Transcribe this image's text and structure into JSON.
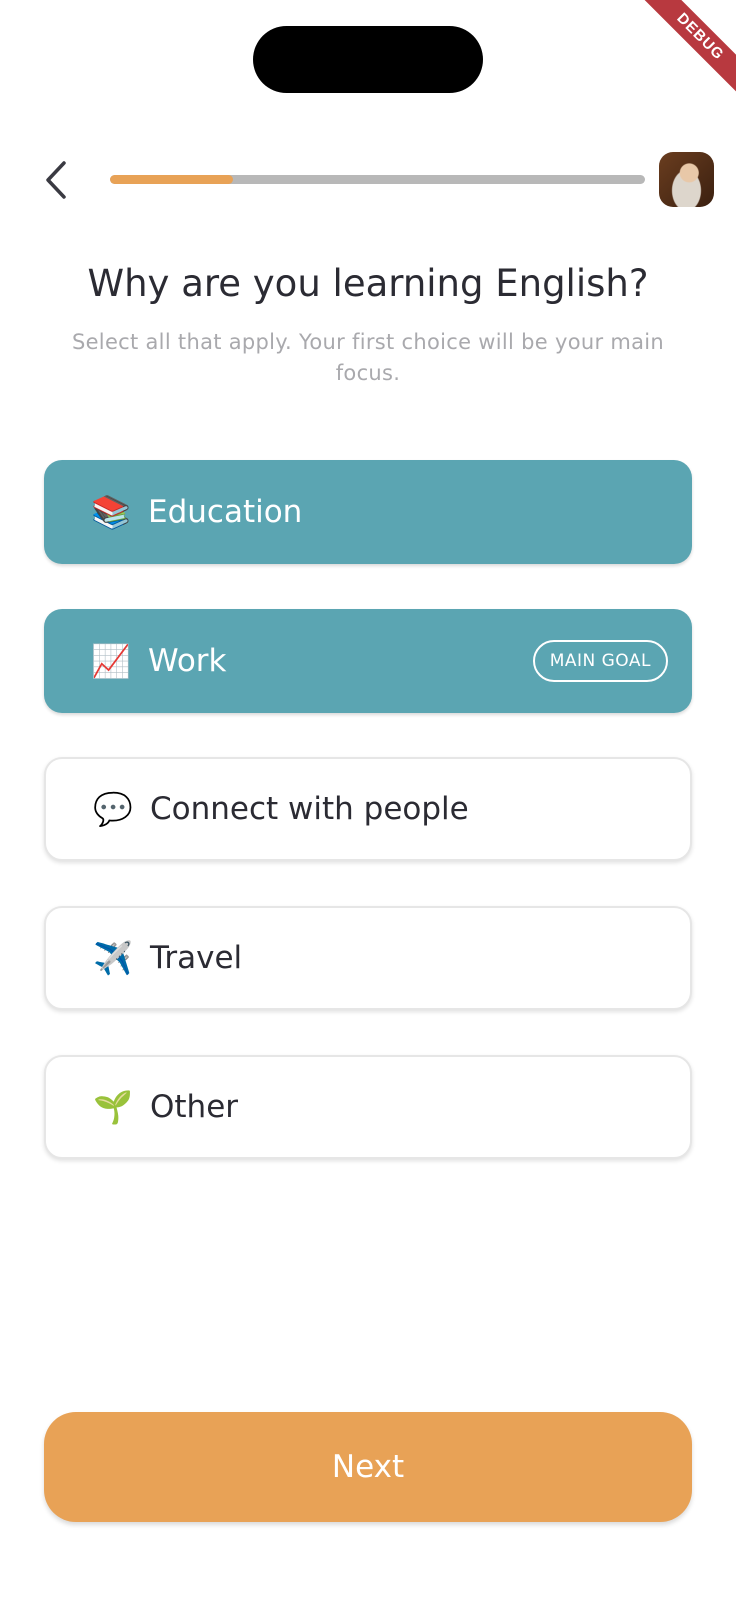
{
  "debug_banner": "DEBUG",
  "header": {
    "back_icon": "chevron-left-icon",
    "progress_fraction": 0.23,
    "progress_color": "#e8a256",
    "track_color": "#b8b8b8"
  },
  "question": {
    "title": "Why are you learning English?",
    "subtitle": "Select all that apply. Your first choice will be your main focus."
  },
  "options": [
    {
      "emoji": "📚",
      "label": "Education",
      "selected": true
    },
    {
      "emoji": "📈",
      "label": "Work",
      "selected": true,
      "badge": "MAIN GOAL"
    },
    {
      "emoji": "💬",
      "label": "Connect with people",
      "selected": false
    },
    {
      "emoji": "✈️",
      "label": "Travel",
      "selected": false
    },
    {
      "emoji": "🌱",
      "label": "Other",
      "selected": false
    }
  ],
  "colors": {
    "selected": "#5ba5b2",
    "accent": "#e8a256"
  },
  "footer": {
    "next_label": "Next"
  }
}
